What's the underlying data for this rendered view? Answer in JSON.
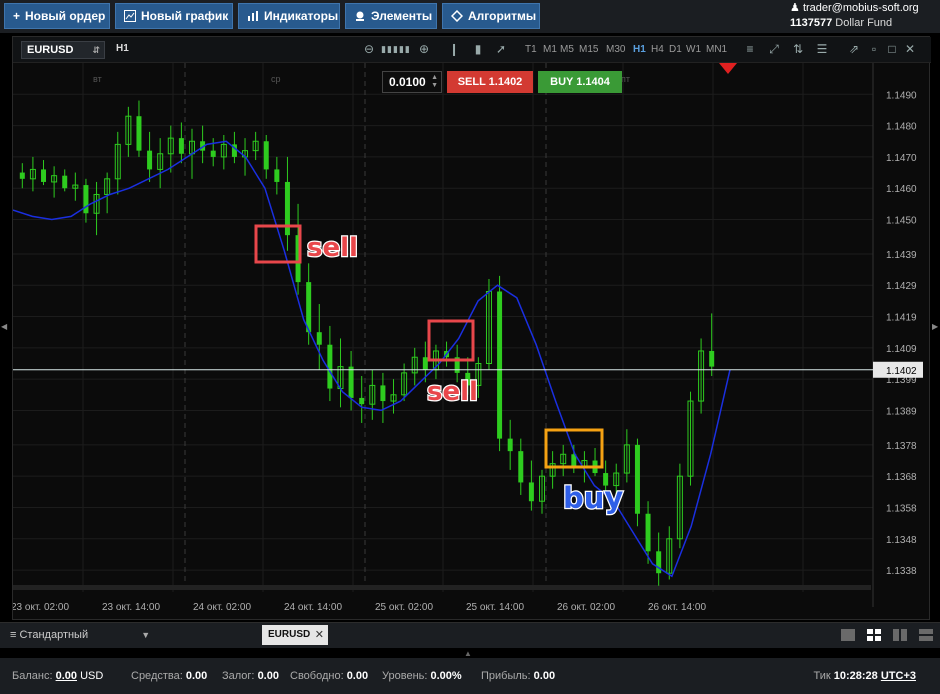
{
  "toolbar": {
    "new_order": "Новый ордер",
    "new_chart": "Новый график",
    "indicators": "Индикаторы",
    "elements": "Элементы",
    "algorithms": "Алгоритмы"
  },
  "account": {
    "email": "trader@mobius-soft.org",
    "number": "1137577",
    "fund": "Dollar Fund"
  },
  "chart": {
    "symbol": "EURUSD",
    "timeframe": "H1",
    "timeframes": [
      "T1",
      "M1",
      "M5",
      "M15",
      "M30",
      "H1",
      "H4",
      "D1",
      "W1",
      "MN1"
    ],
    "active_timeframe": "H1",
    "lot": "0.0100",
    "sell_label": "SELL 1.1402",
    "buy_label": "BUY 1.1404",
    "current_price": "1.1402"
  },
  "chart_data": {
    "type": "candlestick",
    "x_labels": [
      "23 окт. 02:00",
      "23 окт. 14:00",
      "24 окт. 02:00",
      "24 окт. 14:00",
      "25 окт. 02:00",
      "25 окт. 14:00",
      "26 окт. 02:00",
      "26 окт. 14:00"
    ],
    "day_labels": [
      "вт",
      "ср",
      "пт"
    ],
    "y_ticks": [
      "1.1490",
      "1.1480",
      "1.1470",
      "1.1460",
      "1.1450",
      "1.1439",
      "1.1429",
      "1.1419",
      "1.1409",
      "1.1399",
      "1.1389",
      "1.1378",
      "1.1368",
      "1.1358",
      "1.1348",
      "1.1338"
    ],
    "y_range": [
      1.1331,
      1.15
    ],
    "current_price": 1.1402,
    "annotations": [
      {
        "text": "sell",
        "color": "#e8474b"
      },
      {
        "text": "sell",
        "color": "#e8474b"
      },
      {
        "text": "buy",
        "color": "#2f5fe8"
      }
    ],
    "ohlc": [
      [
        1.1465,
        1.1468,
        1.146,
        1.1463
      ],
      [
        1.1463,
        1.147,
        1.1459,
        1.1466
      ],
      [
        1.1466,
        1.1469,
        1.1461,
        1.1462
      ],
      [
        1.1462,
        1.1467,
        1.1457,
        1.1464
      ],
      [
        1.1464,
        1.1466,
        1.1459,
        1.146
      ],
      [
        1.146,
        1.1465,
        1.1456,
        1.1461
      ],
      [
        1.1461,
        1.1463,
        1.1449,
        1.1452
      ],
      [
        1.1452,
        1.1462,
        1.1445,
        1.1458
      ],
      [
        1.1458,
        1.1465,
        1.1452,
        1.1463
      ],
      [
        1.1463,
        1.1478,
        1.1458,
        1.1474
      ],
      [
        1.1474,
        1.1486,
        1.147,
        1.1483
      ],
      [
        1.1483,
        1.1488,
        1.147,
        1.1472
      ],
      [
        1.1472,
        1.1478,
        1.1462,
        1.1466
      ],
      [
        1.1466,
        1.1476,
        1.146,
        1.1471
      ],
      [
        1.1471,
        1.148,
        1.1465,
        1.1476
      ],
      [
        1.1476,
        1.1481,
        1.1468,
        1.1471
      ],
      [
        1.1471,
        1.1479,
        1.1463,
        1.1475
      ],
      [
        1.1475,
        1.148,
        1.1468,
        1.1472
      ],
      [
        1.1472,
        1.1476,
        1.1467,
        1.147
      ],
      [
        1.147,
        1.1477,
        1.1466,
        1.1474
      ],
      [
        1.1474,
        1.1478,
        1.1468,
        1.147
      ],
      [
        1.147,
        1.1476,
        1.1464,
        1.1472
      ],
      [
        1.1472,
        1.1478,
        1.1469,
        1.1475
      ],
      [
        1.1475,
        1.1477,
        1.1463,
        1.1466
      ],
      [
        1.1466,
        1.147,
        1.1458,
        1.1462
      ],
      [
        1.1462,
        1.147,
        1.144,
        1.1445
      ],
      [
        1.1445,
        1.1455,
        1.1426,
        1.143
      ],
      [
        1.143,
        1.1436,
        1.141,
        1.1414
      ],
      [
        1.1414,
        1.1423,
        1.1402,
        1.141
      ],
      [
        1.141,
        1.1416,
        1.1392,
        1.1396
      ],
      [
        1.1396,
        1.1412,
        1.139,
        1.1403
      ],
      [
        1.1403,
        1.1408,
        1.1389,
        1.1393
      ],
      [
        1.1393,
        1.14,
        1.1385,
        1.1391
      ],
      [
        1.1391,
        1.1402,
        1.1386,
        1.1397
      ],
      [
        1.1397,
        1.1401,
        1.1385,
        1.1392
      ],
      [
        1.1392,
        1.1399,
        1.1388,
        1.1394
      ],
      [
        1.1394,
        1.1404,
        1.1392,
        1.1401
      ],
      [
        1.1401,
        1.1409,
        1.1397,
        1.1406
      ],
      [
        1.1406,
        1.1411,
        1.1398,
        1.1402
      ],
      [
        1.1402,
        1.141,
        1.1399,
        1.1408
      ],
      [
        1.1408,
        1.1411,
        1.1403,
        1.1406
      ],
      [
        1.1406,
        1.141,
        1.1398,
        1.1401
      ],
      [
        1.1401,
        1.1406,
        1.1394,
        1.1397
      ],
      [
        1.1397,
        1.1406,
        1.1393,
        1.1404
      ],
      [
        1.1404,
        1.1431,
        1.1402,
        1.1427
      ],
      [
        1.1427,
        1.1432,
        1.1376,
        1.138
      ],
      [
        1.138,
        1.1386,
        1.137,
        1.1376
      ],
      [
        1.1376,
        1.138,
        1.1362,
        1.1366
      ],
      [
        1.1366,
        1.1373,
        1.1357,
        1.136
      ],
      [
        1.136,
        1.137,
        1.1356,
        1.1368
      ],
      [
        1.1368,
        1.1376,
        1.1364,
        1.1372
      ],
      [
        1.1372,
        1.1378,
        1.1368,
        1.1375
      ],
      [
        1.1375,
        1.1378,
        1.1369,
        1.1371
      ],
      [
        1.1371,
        1.1376,
        1.1366,
        1.1373
      ],
      [
        1.1373,
        1.1377,
        1.1368,
        1.1369
      ],
      [
        1.1369,
        1.1373,
        1.1362,
        1.1365
      ],
      [
        1.1365,
        1.1372,
        1.136,
        1.1369
      ],
      [
        1.1369,
        1.1383,
        1.1366,
        1.1378
      ],
      [
        1.1378,
        1.138,
        1.1352,
        1.1356
      ],
      [
        1.1356,
        1.136,
        1.134,
        1.1344
      ],
      [
        1.1344,
        1.135,
        1.1333,
        1.1337
      ],
      [
        1.1337,
        1.1352,
        1.1335,
        1.1348
      ],
      [
        1.1348,
        1.1372,
        1.1345,
        1.1368
      ],
      [
        1.1368,
        1.1395,
        1.1365,
        1.1392
      ],
      [
        1.1392,
        1.1412,
        1.1388,
        1.1408
      ],
      [
        1.1408,
        1.142,
        1.14,
        1.1403
      ]
    ],
    "ma": [
      1.1453,
      1.1451,
      1.145,
      1.1451,
      1.1455,
      1.1458,
      1.146,
      1.1463,
      1.1466,
      1.147,
      1.1474,
      1.1475,
      1.147,
      1.146,
      1.144,
      1.1418,
      1.1405,
      1.1395,
      1.139,
      1.1389,
      1.1392,
      1.1398,
      1.1404,
      1.1412,
      1.1424,
      1.1429,
      1.1425,
      1.141,
      1.1392,
      1.1375,
      1.1365,
      1.136,
      1.135,
      1.134,
      1.1336,
      1.1352,
      1.1375,
      1.1402
    ]
  },
  "tabbar": {
    "template": "Стандартный",
    "tab": "EURUSD"
  },
  "status": {
    "balance_label": "Баланс:",
    "balance_value": "0.00",
    "balance_currency": "USD",
    "funds_label": "Средства:",
    "funds_value": "0.00",
    "margin_label": "Залог:",
    "margin_value": "0.00",
    "free_label": "Свободно:",
    "free_value": "0.00",
    "level_label": "Уровень:",
    "level_value": "0.00%",
    "profit_label": "Прибыль:",
    "profit_value": "0.00",
    "tick_label": "Тик",
    "time": "10:28:28",
    "utc": "UTC+3"
  }
}
